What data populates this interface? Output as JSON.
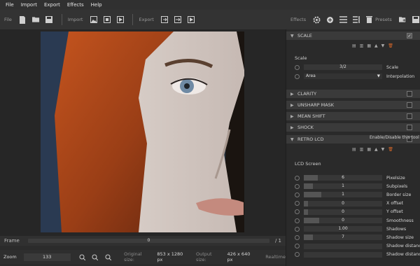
{
  "menu": [
    "File",
    "Import",
    "Export",
    "Effects",
    "Help"
  ],
  "toolbar": {
    "file_label": "File",
    "import_label": "Import",
    "export_label": "Export"
  },
  "right_toolbar": {
    "effects_label": "Effects",
    "presets_label": "Presets"
  },
  "frame": {
    "label": "Frame",
    "value": "0",
    "total": "/ 1"
  },
  "status": {
    "zoom_label": "Zoom",
    "zoom_value": "133",
    "original_label": "Original size:",
    "original_value": "853 x 1280 px",
    "output_label": "Output size:",
    "output_value": "426 x 640 px",
    "realtime_label": "Realtime"
  },
  "scale_section": {
    "title": "SCALE",
    "group": "Scale",
    "scale_value": "3/2",
    "scale_name": "Scale",
    "interp_value": "Area",
    "interp_name": "Interpolation"
  },
  "sections": [
    "CLARITY",
    "UNSHARP MASK",
    "MEAN SHIFT",
    "SHOCK",
    "RETRO LCD"
  ],
  "tooltip": "Enable/Disable this tool",
  "lcd": {
    "group": "LCD Screen",
    "params": [
      {
        "name": "Pixelsize",
        "value": "6",
        "fill": 0.18
      },
      {
        "name": "Subpixels",
        "value": "1",
        "fill": 0.12
      },
      {
        "name": "Border size",
        "value": "1",
        "fill": 0.22
      },
      {
        "name": "X offset",
        "value": "0",
        "fill": 0.05
      },
      {
        "name": "Y offset",
        "value": "0",
        "fill": 0.05
      },
      {
        "name": "Smoothness",
        "value": "0",
        "fill": 0.2
      },
      {
        "name": "Shadows",
        "value": "1.00",
        "fill": 0.0
      },
      {
        "name": "Shadow size",
        "value": "7",
        "fill": 0.12
      },
      {
        "name": "Shadow distance",
        "value": "",
        "fill": 0.0
      },
      {
        "name": "Shadow distance",
        "value": "",
        "fill": 0.0
      }
    ]
  }
}
